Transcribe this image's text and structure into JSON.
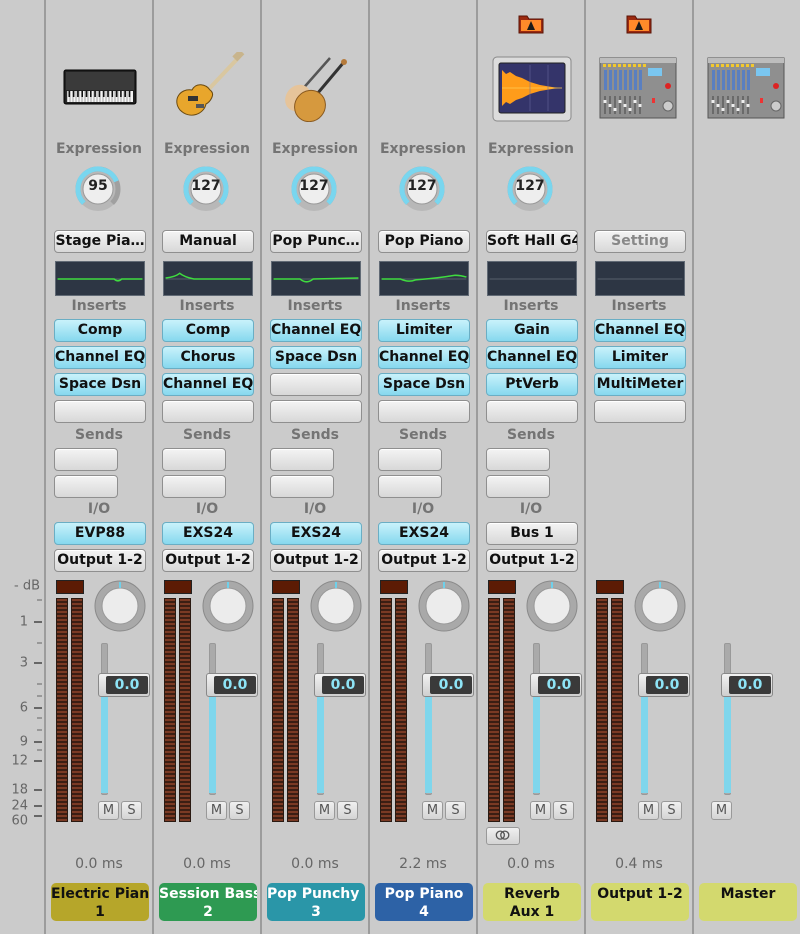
{
  "db_scale": {
    "unit_label": "- dB",
    "marks": [
      "1",
      "3",
      "6",
      "9",
      "12",
      "18",
      "24",
      "60"
    ]
  },
  "strips": [
    {
      "name_line1": "Electric Pian",
      "name_line2": "1",
      "tag_color": "#b6a62a",
      "tag_text_color": "#111111",
      "has_folder_icon": false,
      "instrument_icon": "electric-piano-icon",
      "expression_label": "Expression",
      "expression_value": "95",
      "expression_fraction": 0.75,
      "setting": "Stage Pia…",
      "setting_dim": false,
      "eq_curve": "flat-dip",
      "inserts_label": "Inserts",
      "inserts": [
        "Comp",
        "Channel EQ",
        "Space Dsn",
        ""
      ],
      "sends_label": "Sends",
      "sends": [
        "",
        ""
      ],
      "io_label": "I/O",
      "input": "EVP88",
      "input_style": "blue",
      "output": "Output 1-2",
      "has_pan": true,
      "has_meter": true,
      "fader_value": "0.0",
      "mute_label": "M",
      "solo_label": "S",
      "has_solo": true,
      "has_link": false,
      "latency": "0.0 ms"
    },
    {
      "name_line1": "Session Bass",
      "name_line2": "2",
      "tag_color": "#2e9a52",
      "tag_text_color": "#ffffff",
      "has_folder_icon": false,
      "instrument_icon": "bass-guitar-icon",
      "expression_label": "Expression",
      "expression_value": "127",
      "expression_fraction": 1.0,
      "setting": "Manual",
      "setting_dim": false,
      "eq_curve": "low-bump",
      "inserts_label": "Inserts",
      "inserts": [
        "Comp",
        "Chorus",
        "Channel EQ",
        ""
      ],
      "sends_label": "Sends",
      "sends": [
        "",
        ""
      ],
      "io_label": "I/O",
      "input": "EXS24",
      "input_style": "blue",
      "output": "Output 1-2",
      "has_pan": true,
      "has_meter": true,
      "fader_value": "0.0",
      "mute_label": "M",
      "solo_label": "S",
      "has_solo": true,
      "has_link": false,
      "latency": "0.0 ms"
    },
    {
      "name_line1": "Pop Punchy S",
      "name_line2": "3",
      "tag_color": "#2a96a8",
      "tag_text_color": "#ffffff",
      "has_folder_icon": false,
      "instrument_icon": "violins-icon",
      "expression_label": "Expression",
      "expression_value": "127",
      "expression_fraction": 1.0,
      "setting": "Pop Punc…",
      "setting_dim": false,
      "eq_curve": "mid-dip",
      "inserts_label": "Inserts",
      "inserts": [
        "Channel EQ",
        "Space Dsn",
        "",
        ""
      ],
      "sends_label": "Sends",
      "sends": [
        "",
        ""
      ],
      "io_label": "I/O",
      "input": "EXS24",
      "input_style": "blue",
      "output": "Output 1-2",
      "has_pan": true,
      "has_meter": true,
      "fader_value": "0.0",
      "mute_label": "M",
      "solo_label": "S",
      "has_solo": true,
      "has_link": false,
      "latency": "0.0 ms"
    },
    {
      "name_line1": "Pop Piano",
      "name_line2": "4",
      "tag_color": "#2d62a6",
      "tag_text_color": "#ffffff",
      "has_folder_icon": false,
      "instrument_icon": "",
      "expression_label": "Expression",
      "expression_value": "127",
      "expression_fraction": 1.0,
      "setting": "Pop Piano",
      "setting_dim": false,
      "eq_curve": "high-lift",
      "inserts_label": "Inserts",
      "inserts": [
        "Limiter",
        "Channel EQ",
        "Space Dsn",
        ""
      ],
      "sends_label": "Sends",
      "sends": [
        "",
        ""
      ],
      "io_label": "I/O",
      "input": "EXS24",
      "input_style": "blue",
      "output": "Output 1-2",
      "has_pan": true,
      "has_meter": true,
      "fader_value": "0.0",
      "mute_label": "M",
      "solo_label": "S",
      "has_solo": true,
      "has_link": false,
      "latency": "2.2 ms"
    },
    {
      "name_line1": "Reverb",
      "name_line2": "Aux 1",
      "tag_color": "#d3d96e",
      "tag_text_color": "#111111",
      "has_folder_icon": true,
      "instrument_icon": "reverb-waveform-icon",
      "expression_label": "Expression",
      "expression_value": "127",
      "expression_fraction": 1.0,
      "setting": "Soft Hall G4",
      "setting_dim": false,
      "eq_curve": "none",
      "inserts_label": "Inserts",
      "inserts": [
        "Gain",
        "Channel EQ",
        "PtVerb",
        ""
      ],
      "sends_label": "Sends",
      "sends": [
        "",
        ""
      ],
      "io_label": "I/O",
      "input": "Bus 1",
      "input_style": "gray",
      "output": "Output 1-2",
      "has_pan": true,
      "has_meter": true,
      "fader_value": "0.0",
      "mute_label": "M",
      "solo_label": "S",
      "has_solo": true,
      "has_link": true,
      "latency": "0.0 ms"
    },
    {
      "name_line1": "Output 1-2",
      "name_line2": "",
      "tag_color": "#d3d96e",
      "tag_text_color": "#111111",
      "has_folder_icon": true,
      "instrument_icon": "mixing-console-icon",
      "expression_label": "",
      "expression_value": "",
      "setting": "Setting",
      "setting_dim": true,
      "eq_curve": "none",
      "inserts_label": "Inserts",
      "inserts": [
        "Channel EQ",
        "Limiter",
        "MultiMeter",
        ""
      ],
      "sends_label": "",
      "sends": [],
      "io_label": "",
      "input": "",
      "output": "",
      "has_pan": true,
      "has_meter": true,
      "fader_value": "0.0",
      "mute_label": "M",
      "solo_label": "S",
      "has_solo": true,
      "has_link": false,
      "latency": "0.4 ms"
    },
    {
      "name_line1": "Master",
      "name_line2": "",
      "tag_color": "#d3d96e",
      "tag_text_color": "#111111",
      "has_folder_icon": false,
      "instrument_icon": "mixing-console-icon",
      "expression_label": "",
      "expression_value": "",
      "setting": "",
      "eq_curve": "",
      "inserts_label": "",
      "inserts": [],
      "sends_label": "",
      "sends": [],
      "io_label": "",
      "input": "",
      "output": "",
      "has_pan": false,
      "has_meter": false,
      "fader_value": "0.0",
      "mute_label": "M",
      "solo_label": "",
      "has_solo": false,
      "has_link": false,
      "latency": ""
    }
  ]
}
